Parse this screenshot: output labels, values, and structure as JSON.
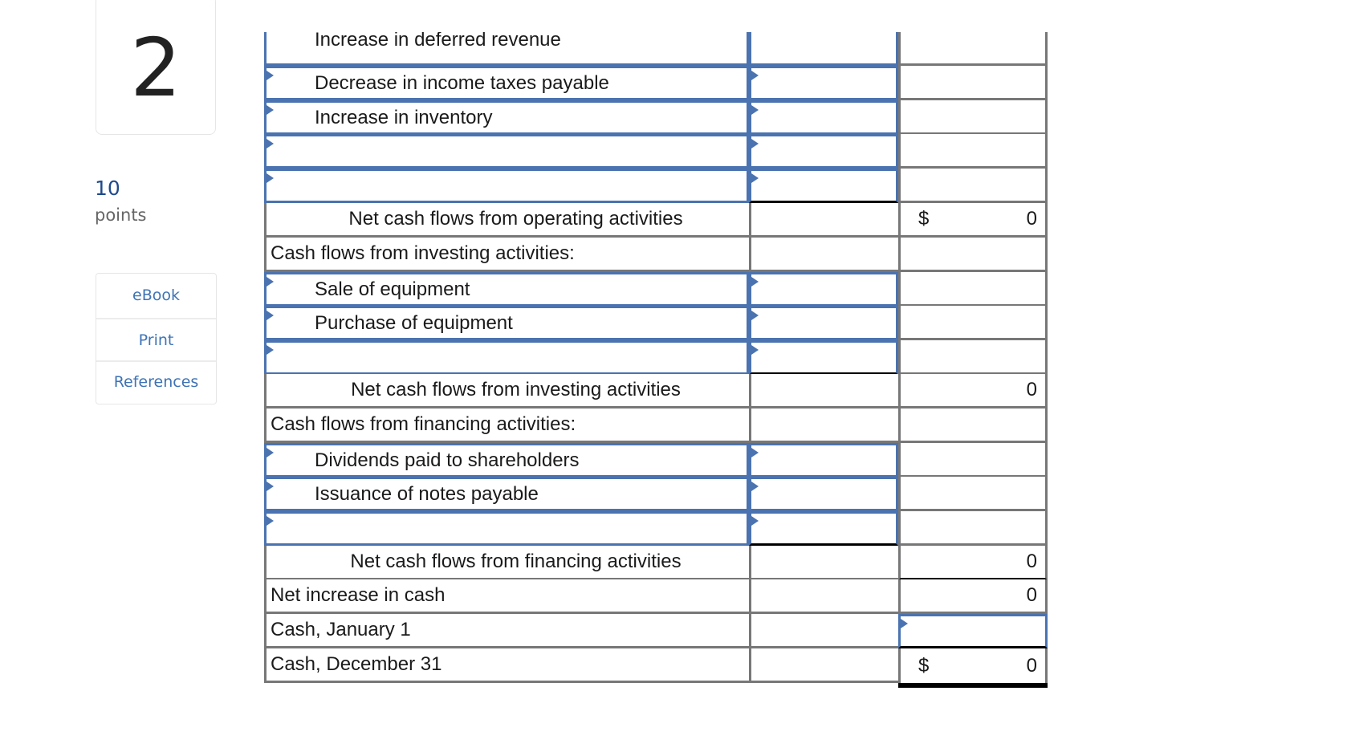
{
  "question": {
    "number": "2",
    "points_value": "10",
    "points_label": "points"
  },
  "tools": [
    {
      "label": "eBook"
    },
    {
      "label": "Print"
    },
    {
      "label": "References"
    }
  ],
  "worksheet": {
    "currency_symbol": "$",
    "rows": [
      {
        "label": "Increase in deferred revenue",
        "type": "input-partial"
      },
      {
        "label": "Decrease in income taxes payable",
        "type": "input"
      },
      {
        "label": "Increase in inventory",
        "type": "input"
      },
      {
        "label": "",
        "type": "input"
      },
      {
        "label": "",
        "type": "input"
      },
      {
        "label": "Net cash flows from operating activities",
        "type": "subtotal",
        "dollar": "$",
        "total": "0"
      },
      {
        "label": "Cash flows from investing activities:",
        "type": "heading"
      },
      {
        "label": "Sale of equipment",
        "type": "input"
      },
      {
        "label": "Purchase of equipment",
        "type": "input"
      },
      {
        "label": "",
        "type": "input"
      },
      {
        "label": "Net cash flows from investing activities",
        "type": "subtotal",
        "dollar": "",
        "total": "0"
      },
      {
        "label": "Cash flows from financing activities:",
        "type": "heading"
      },
      {
        "label": "Dividends paid to shareholders",
        "type": "input"
      },
      {
        "label": "Issuance of notes payable",
        "type": "input"
      },
      {
        "label": "",
        "type": "input"
      },
      {
        "label": "Net cash flows from financing activities",
        "type": "subtotal",
        "dollar": "",
        "total": "0"
      },
      {
        "label": "Net increase in cash",
        "type": "heading-total",
        "total": "0"
      },
      {
        "label": "Cash, January 1",
        "type": "heading-input-right",
        "total": ""
      },
      {
        "label": "Cash, December 31",
        "type": "grand-total",
        "dollar": "$",
        "total": "0"
      }
    ]
  }
}
